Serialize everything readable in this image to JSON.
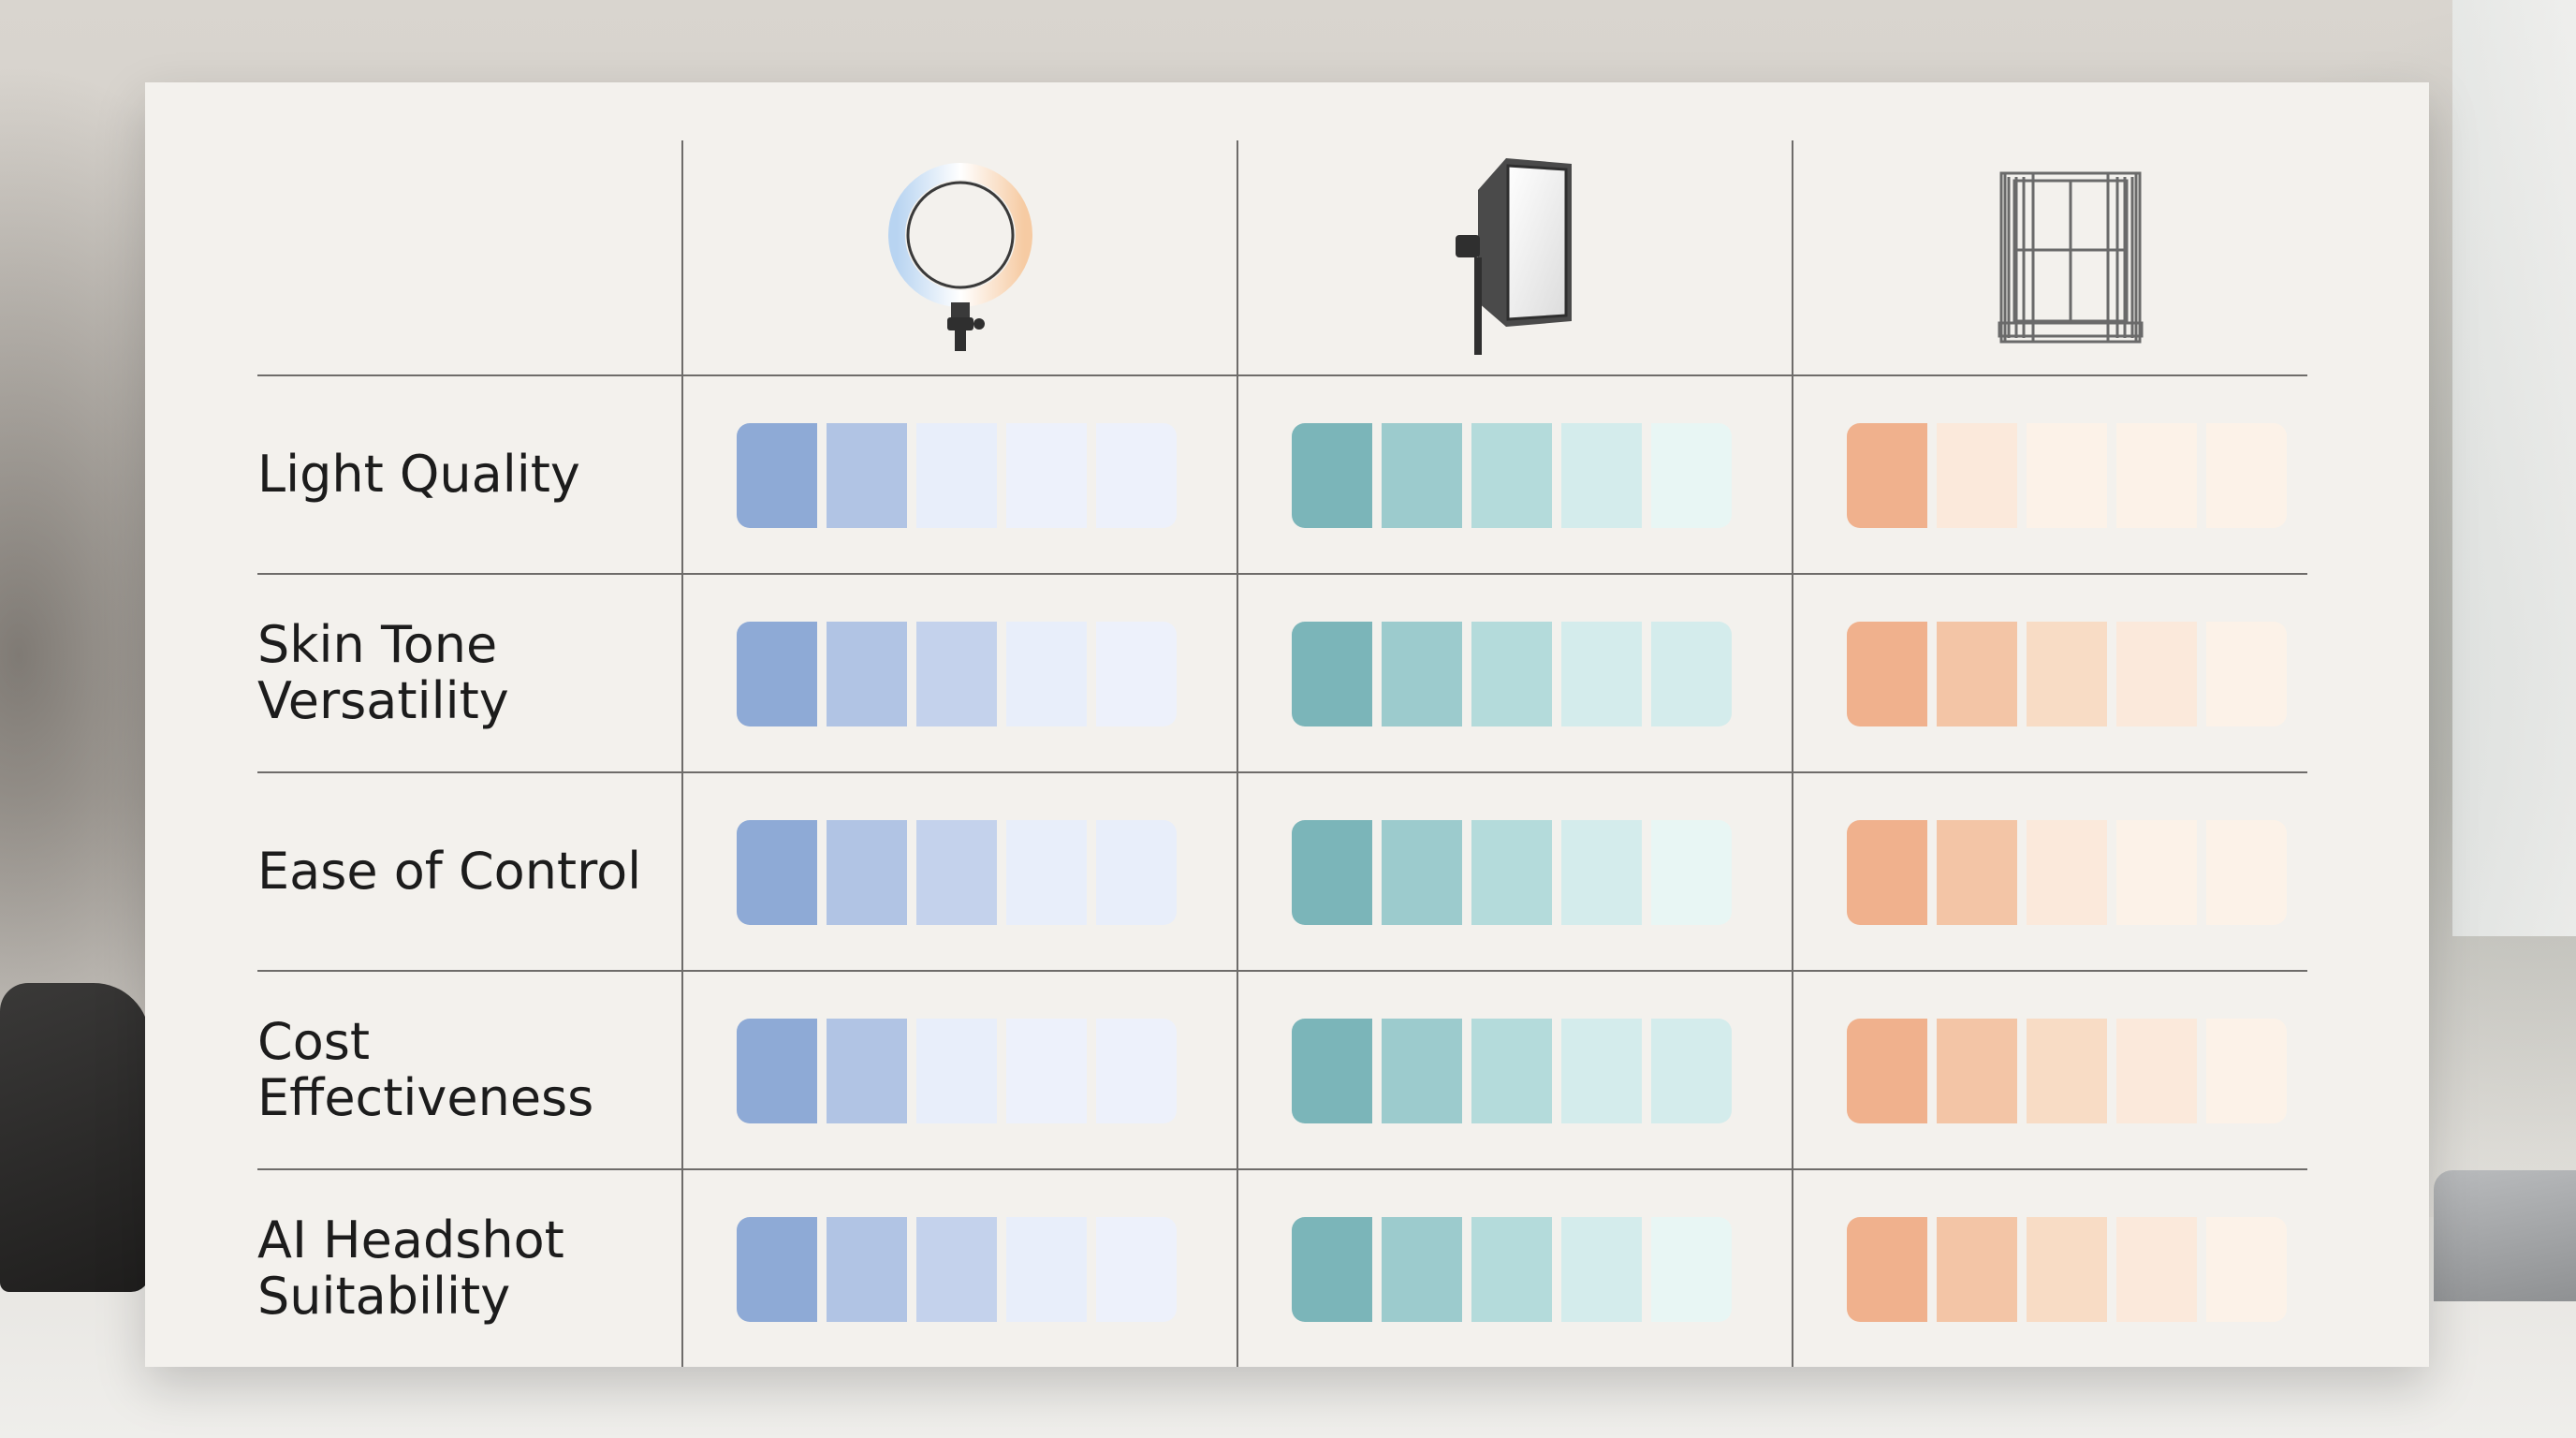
{
  "columns": [
    {
      "icon": "ring-light-icon"
    },
    {
      "icon": "softbox-icon"
    },
    {
      "icon": "window-light-icon"
    }
  ],
  "rows": [
    {
      "label": "Light Quality",
      "ratings": [
        2,
        5,
        1
      ]
    },
    {
      "label": "Skin Tone\nVersatility",
      "ratings": [
        3,
        4,
        3
      ]
    },
    {
      "label": "Ease of Control",
      "ratings": [
        4,
        3,
        2
      ]
    },
    {
      "label": "Cost\nEffectiveness",
      "ratings": [
        2,
        4,
        5
      ]
    },
    {
      "label": "AI Headshot\nSuitability",
      "ratings": [
        3,
        5,
        3
      ]
    }
  ],
  "scale_max": 5,
  "colors": {
    "blue": [
      "#8eaad6",
      "#b1c4e4",
      "#c4d2ec",
      "#e8eefa",
      "#edf1fb"
    ],
    "teal": [
      "#7bb5b9",
      "#9ccbcd",
      "#b4dbdb",
      "#d4ecec",
      "#e8f6f4"
    ],
    "peach": [
      "#f0b18d",
      "#f3c5a6",
      "#f8dcc5",
      "#fbe9db",
      "#fcf2e8"
    ]
  }
}
